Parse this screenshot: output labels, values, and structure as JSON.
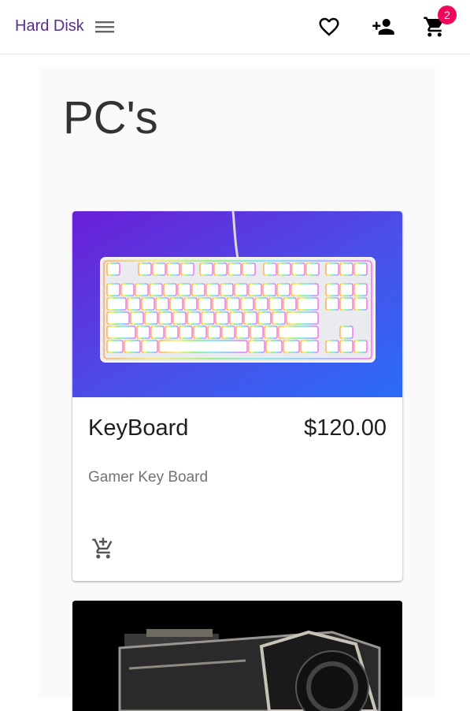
{
  "header": {
    "brand": "Hard Disk",
    "cart_count": "2",
    "icons": [
      "menu-icon",
      "heart-icon",
      "add-user-icon",
      "cart-icon"
    ],
    "brand_color": "#5a2d91",
    "badge_color": "#f0085a"
  },
  "main": {
    "title": "PC's",
    "products": [
      {
        "name": "KeyBoard",
        "price": "$120.00",
        "description": "Gamer Key Board",
        "image": "keyboard-image",
        "action_icon": "add-shopping-cart-icon"
      },
      {
        "image": "graphics-card-image"
      }
    ]
  }
}
